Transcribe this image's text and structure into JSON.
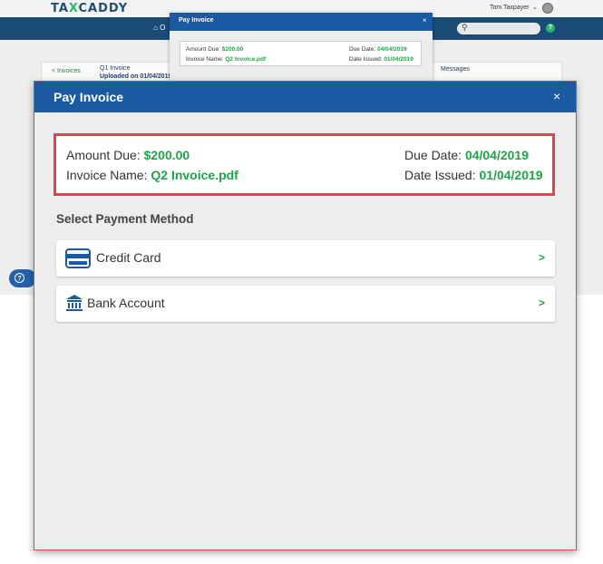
{
  "app": {
    "logo_prefix": "TA",
    "logo_x": "X",
    "logo_suffix": "CADDY",
    "user_name": "Tom Taxpayer",
    "nav_home_label": "O",
    "help_label": "?",
    "back_link": "< Invoices",
    "doc_title": "Q1 Invoice",
    "doc_uploaded": "Uploaded on 01/04/2019",
    "messages_tab": "Messages",
    "support_label": "?"
  },
  "mini_modal": {
    "title": "Pay Invoice",
    "close": "×",
    "amount_label": "Amount Due:",
    "amount_value": "$200.00",
    "invoice_label": "Invoice Name:",
    "invoice_value": "Q2 Invoice.pdf",
    "due_label": "Due Date:",
    "due_value": "04/04/2019",
    "issued_label": "Date Issued:",
    "issued_value": "01/04/2019"
  },
  "modal": {
    "title": "Pay Invoice",
    "close": "×",
    "amount_label": "Amount Due:",
    "amount_value": "$200.00",
    "invoice_label": "Invoice Name:",
    "invoice_value": "Q2 Invoice.pdf",
    "due_label": "Due Date:",
    "due_value": "04/04/2019",
    "issued_label": "Date Issued:",
    "issued_value": "01/04/2019",
    "section_title": "Select Payment Method",
    "options": [
      {
        "label": "Credit Card",
        "icon": "credit-card-icon",
        "arrow": ">"
      },
      {
        "label": "Bank Account",
        "icon": "bank-icon",
        "arrow": ">"
      }
    ]
  },
  "colors": {
    "brand_blue": "#1b5aa0",
    "nav_blue": "#1b4c78",
    "accent_green": "#1fa34a",
    "highlight_red": "#e0454b"
  }
}
